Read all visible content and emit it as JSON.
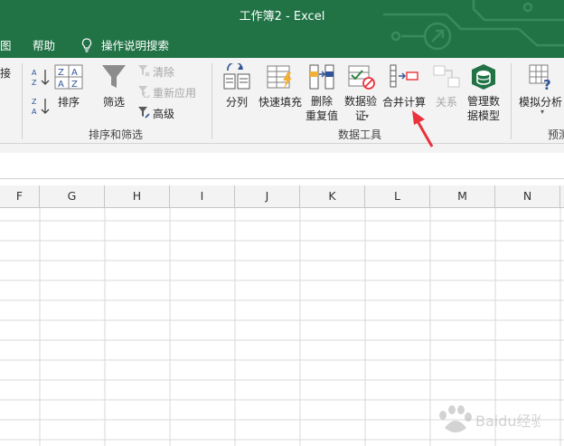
{
  "title": "工作簿2  -  Excel",
  "menu": {
    "left_partial": "图",
    "help": "帮助",
    "search": "操作说明搜索"
  },
  "ribbon": {
    "partial_left": "接",
    "sort_label": "排序",
    "filter_label": "筛选",
    "clear_label": "清除",
    "reapply_label": "重新应用",
    "advanced_label": "高级",
    "sort_filter_group": "排序和筛选",
    "split_label": "分列",
    "flash_fill_label": "快速填充",
    "remove_dup_label": "删除\n重复值",
    "validation_label": "数据验\n证",
    "consolidate_label": "合并计算",
    "relations_label": "关系",
    "manage_model_label": "管理数\n据模型",
    "data_tools_group": "数据工具",
    "whatif_label": "模拟分析",
    "forecast_group_partial": "预测"
  },
  "columns": [
    "F",
    "G",
    "H",
    "I",
    "J",
    "K",
    "L",
    "M",
    "N"
  ],
  "watermark": "Baidu经验",
  "colors": {
    "excel_green": "#217346",
    "annotation_red": "#e8323c"
  }
}
